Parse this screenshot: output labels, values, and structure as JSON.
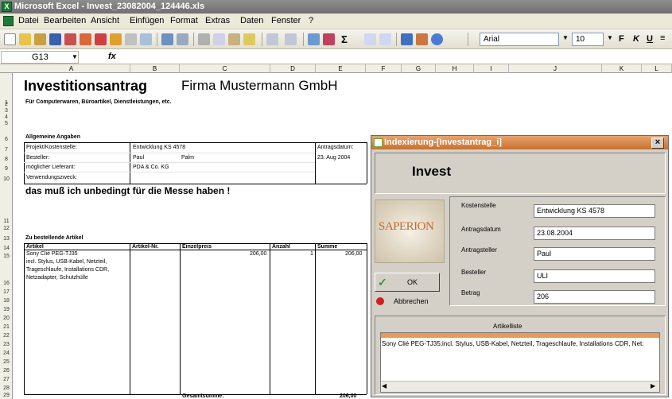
{
  "window": {
    "title": "Microsoft Excel - Invest_23082004_124446.xls",
    "icon": "excel-icon"
  },
  "menu": [
    "Datei",
    "Bearbeiten",
    "Ansicht",
    "Einfügen",
    "Format",
    "Extras",
    "Daten",
    "Fenster",
    "?"
  ],
  "toolbar": {
    "font": "Arial",
    "size": "10",
    "bold": "F",
    "italic": "K",
    "underline": "U"
  },
  "formula": {
    "namebox": "G13",
    "fx": "fx"
  },
  "columns": [
    "A",
    "B",
    "C",
    "D",
    "E",
    "F",
    "G",
    "H",
    "I",
    "J",
    "K",
    "L"
  ],
  "rows": [
    "1",
    "2",
    "3",
    "4",
    "5",
    "6",
    "7",
    "8",
    "9",
    "10",
    "11",
    "12",
    "13",
    "14",
    "15",
    "16",
    "17",
    "18",
    "19",
    "20",
    "21",
    "22",
    "23",
    "24",
    "25",
    "26",
    "27",
    "28",
    "29"
  ],
  "sheet": {
    "title": "Investitionsantrag",
    "company": "Firma Mustermann GmbH",
    "subtitle": "Für Computerwaren, Büroartikel, Dienstleistungen, etc.",
    "general_header": "Allgemeine Angaben",
    "lbl_project": "Projekt/Kostenstelle:",
    "val_project": "Entwicklung KS 4578",
    "lbl_date": "Antragsdatum:",
    "val_date": "23. Aug 2004",
    "lbl_orderer": "Besteller:",
    "val_orderer1": "Paul",
    "val_orderer2": "Palm",
    "lbl_supplier": "möglicher Lieferant:",
    "val_supplier": "PDA & Co. KG",
    "lbl_purpose": "Verwendungszweck:",
    "purpose_text": "das muß ich unbedingt für die Messe haben !",
    "items_header": "Zu bestellende Artikel",
    "col_article": "Artikel",
    "col_article_no": "Artikel-Nr.",
    "col_unit_price": "Einzelpreis",
    "col_qty": "Anzahl",
    "col_sum": "Summe",
    "item_desc": [
      "Sony Clié PEG-TJ35",
      "incl. Stylus, USB-Kabel, Netzteil,",
      "Trageschlaufe, Installations CDR,",
      "Netzadapter, Schutzhülle"
    ],
    "item_price": "206,00",
    "item_qty": "1",
    "item_sum": "206,00",
    "total_label": "Gesamtsumme:",
    "total_value": "206,00"
  },
  "dialog": {
    "title": "Indexierung-[Investantrag_i]",
    "heading": "Invest",
    "logo_text": "SAPERION",
    "lbl_kostenstelle": "Kostenstelle",
    "val_kostenstelle": "Entwicklung KS 4578",
    "lbl_antragsdatum": "Antragsdatum",
    "val_antragsdatum": "23.08.2004",
    "lbl_antragsteller": "Antragsteller",
    "val_antragsteller": "Paul",
    "lbl_besteller": "Besteller",
    "val_besteller": "ULI",
    "lbl_betrag": "Betrag",
    "val_betrag": "206",
    "ok": "OK",
    "cancel": "Abbrechen",
    "list_label": "Artikelliste",
    "list_text": "Sony Clié PEG-TJ35;incl. Stylus, USB-Kabel, Netzteil, Trageschlaufe, Installations CDR, Net:"
  }
}
